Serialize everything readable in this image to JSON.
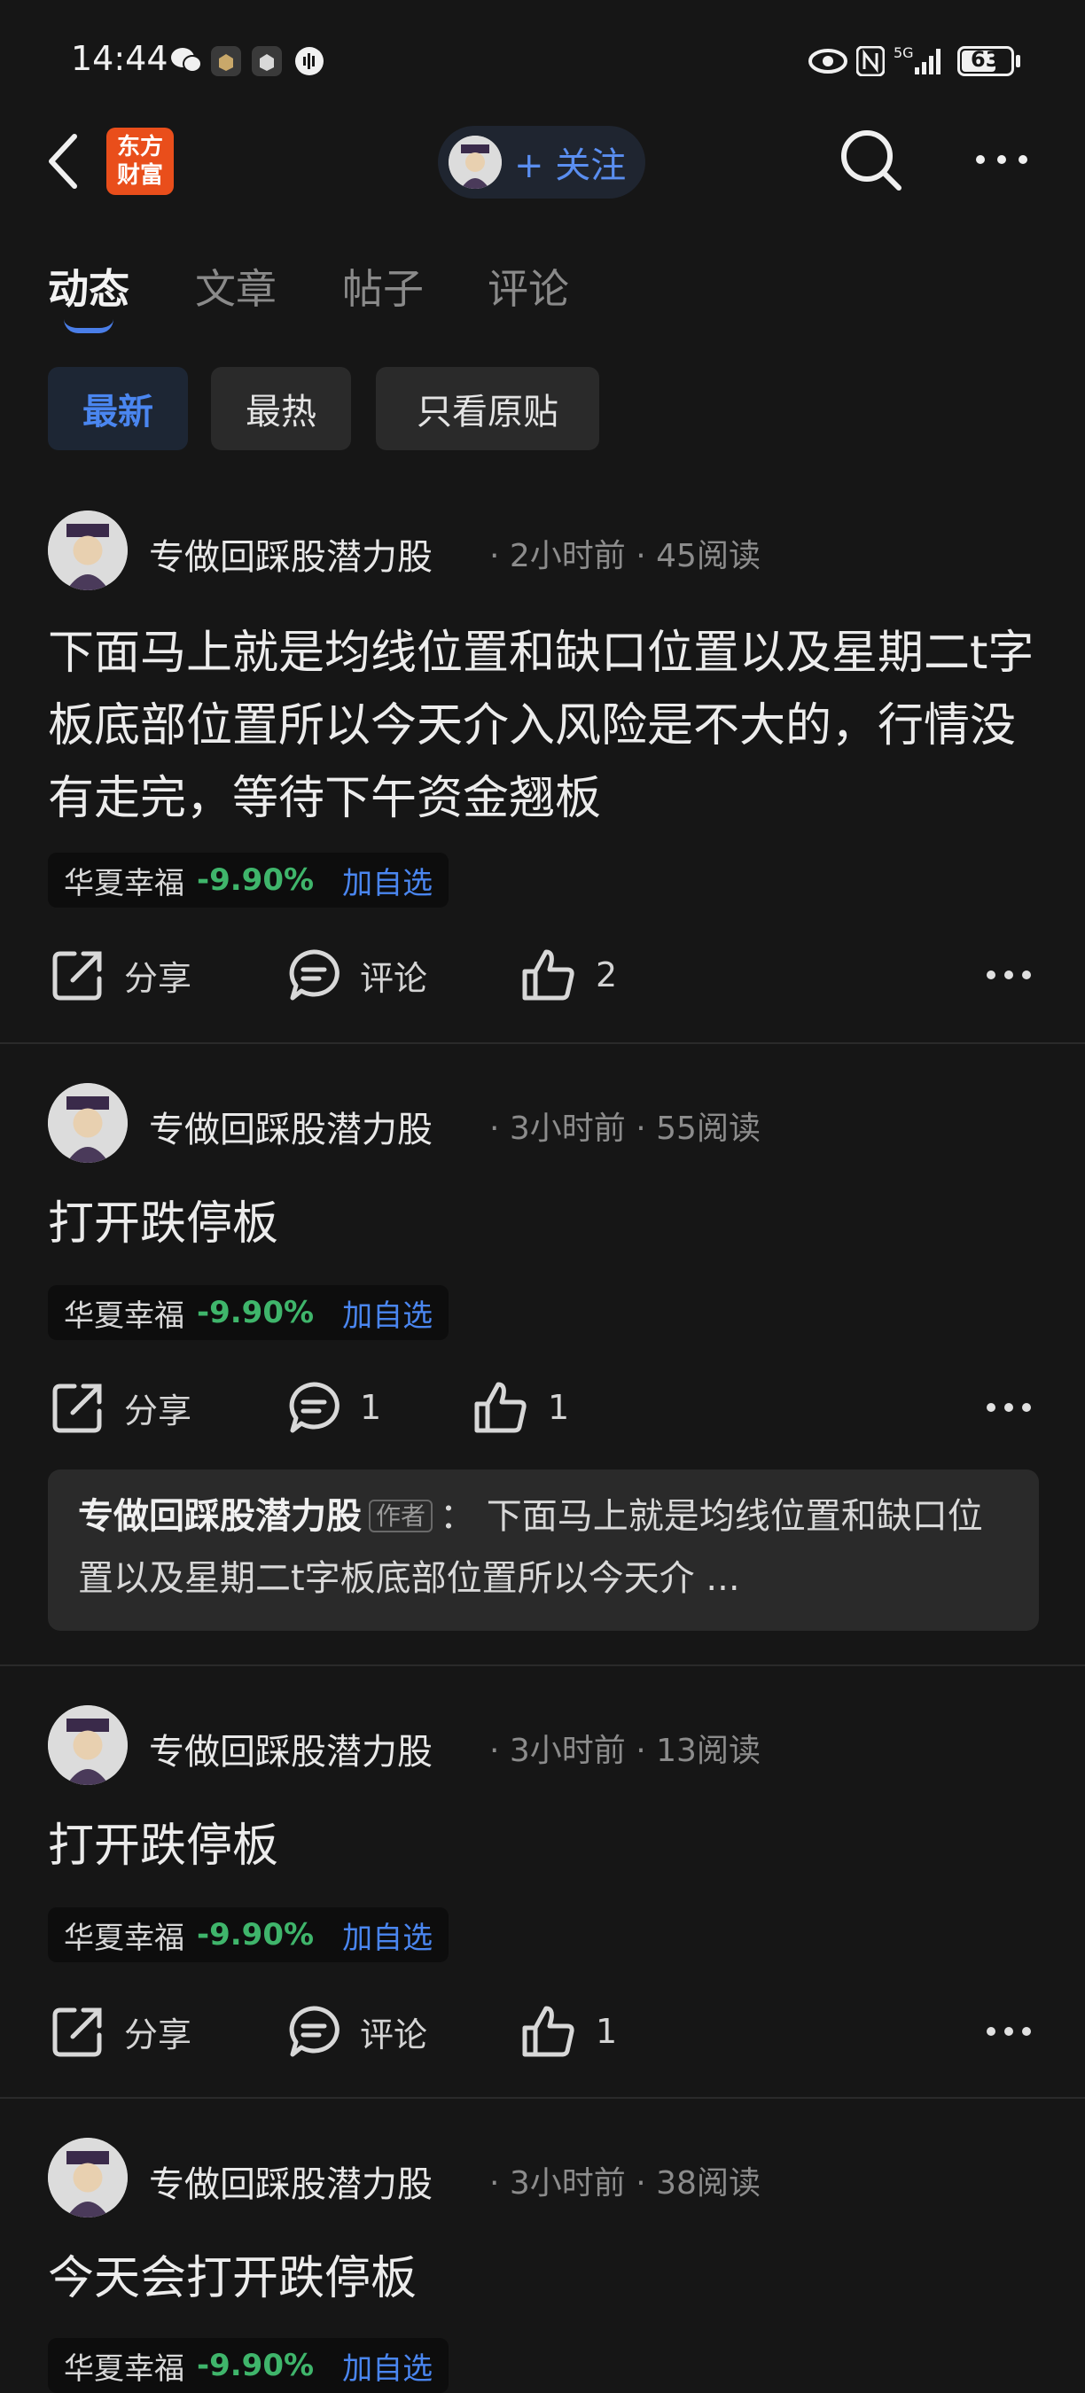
{
  "status_bar": {
    "time": "14:44",
    "battery": "63",
    "network": "5G"
  },
  "header": {
    "logo_text_line1": "东方",
    "logo_text_line2": "财富",
    "follow_label": "+ 关注"
  },
  "tabs": [
    {
      "label": "动态",
      "active": true
    },
    {
      "label": "文章",
      "active": false
    },
    {
      "label": "帖子",
      "active": false
    },
    {
      "label": "评论",
      "active": false
    }
  ],
  "filters": [
    {
      "label": "最新",
      "active": true
    },
    {
      "label": "最热",
      "active": false
    },
    {
      "label": "只看原贴",
      "active": false
    }
  ],
  "posts": [
    {
      "author": "专做回踩股潜力股",
      "time": "2小时前",
      "reads": "45阅读",
      "text": "下面马上就是均线位置和缺口位置以及星期二t字板底部位置所以今天介入风险是不大的，行情没有走完，等待下午资金翘板",
      "stock": {
        "name": "华夏幸福",
        "change": "-9.90%",
        "add": "加自选"
      },
      "share": "分享",
      "comment": "评论",
      "likes": "2"
    },
    {
      "author": "专做回踩股潜力股",
      "time": "3小时前",
      "reads": "55阅读",
      "text": "打开跌停板",
      "stock": {
        "name": "华夏幸福",
        "change": "-9.90%",
        "add": "加自选"
      },
      "share": "分享",
      "comment": "1",
      "likes": "1",
      "quote": {
        "author": "专做回踩股潜力股",
        "tag": "作者",
        "text": "：  下面马上就是均线位置和缺口位置以及星期二t字板底部位置所以今天介 ..."
      }
    },
    {
      "author": "专做回踩股潜力股",
      "time": "3小时前",
      "reads": "13阅读",
      "text": "打开跌停板",
      "stock": {
        "name": "华夏幸福",
        "change": "-9.90%",
        "add": "加自选"
      },
      "share": "分享",
      "comment": "评论",
      "likes": "1"
    },
    {
      "author": "专做回踩股潜力股",
      "time": "3小时前",
      "reads": "38阅读",
      "text": "今天会打开跌停板",
      "stock": {
        "name": "华夏幸福",
        "change": "-9.90%",
        "add": "加自选"
      }
    }
  ],
  "colors": {
    "accent": "#4a86f0",
    "down": "#3fb56b",
    "brand": "#e94e1b"
  }
}
